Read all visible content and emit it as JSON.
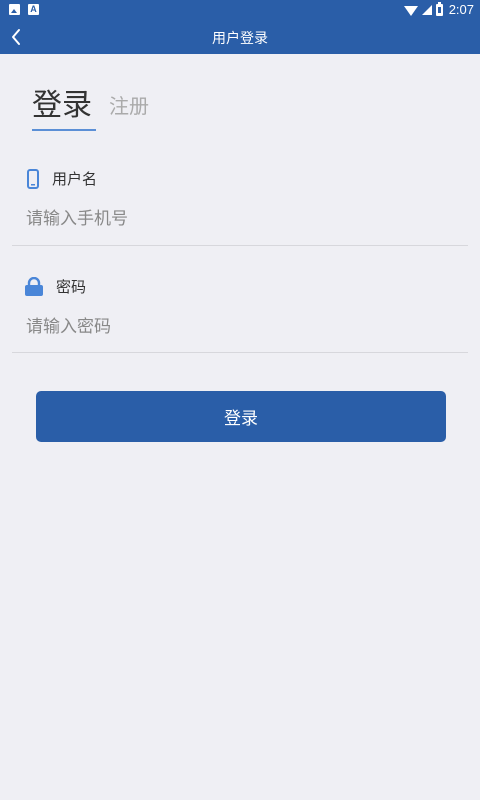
{
  "status_bar": {
    "time": "2:07",
    "icons": [
      "image-notification-icon",
      "font-notification-icon",
      "wifi-icon",
      "signal-icon",
      "battery-icon"
    ]
  },
  "header": {
    "title": "用户登录",
    "back_icon": "chevron-left-icon"
  },
  "tabs": {
    "login": "登录",
    "register": "注册",
    "active": "login"
  },
  "form": {
    "username": {
      "label": "用户名",
      "icon": "phone-icon",
      "placeholder": "请输入手机号",
      "value": ""
    },
    "password": {
      "label": "密码",
      "icon": "lock-icon",
      "placeholder": "请输入密码",
      "value": ""
    }
  },
  "login_button": {
    "label": "登录"
  },
  "colors": {
    "primary": "#2a5ea8",
    "icon_blue": "#4a86d8",
    "background": "#efeff4",
    "tab_underline": "#5b8fd6"
  }
}
